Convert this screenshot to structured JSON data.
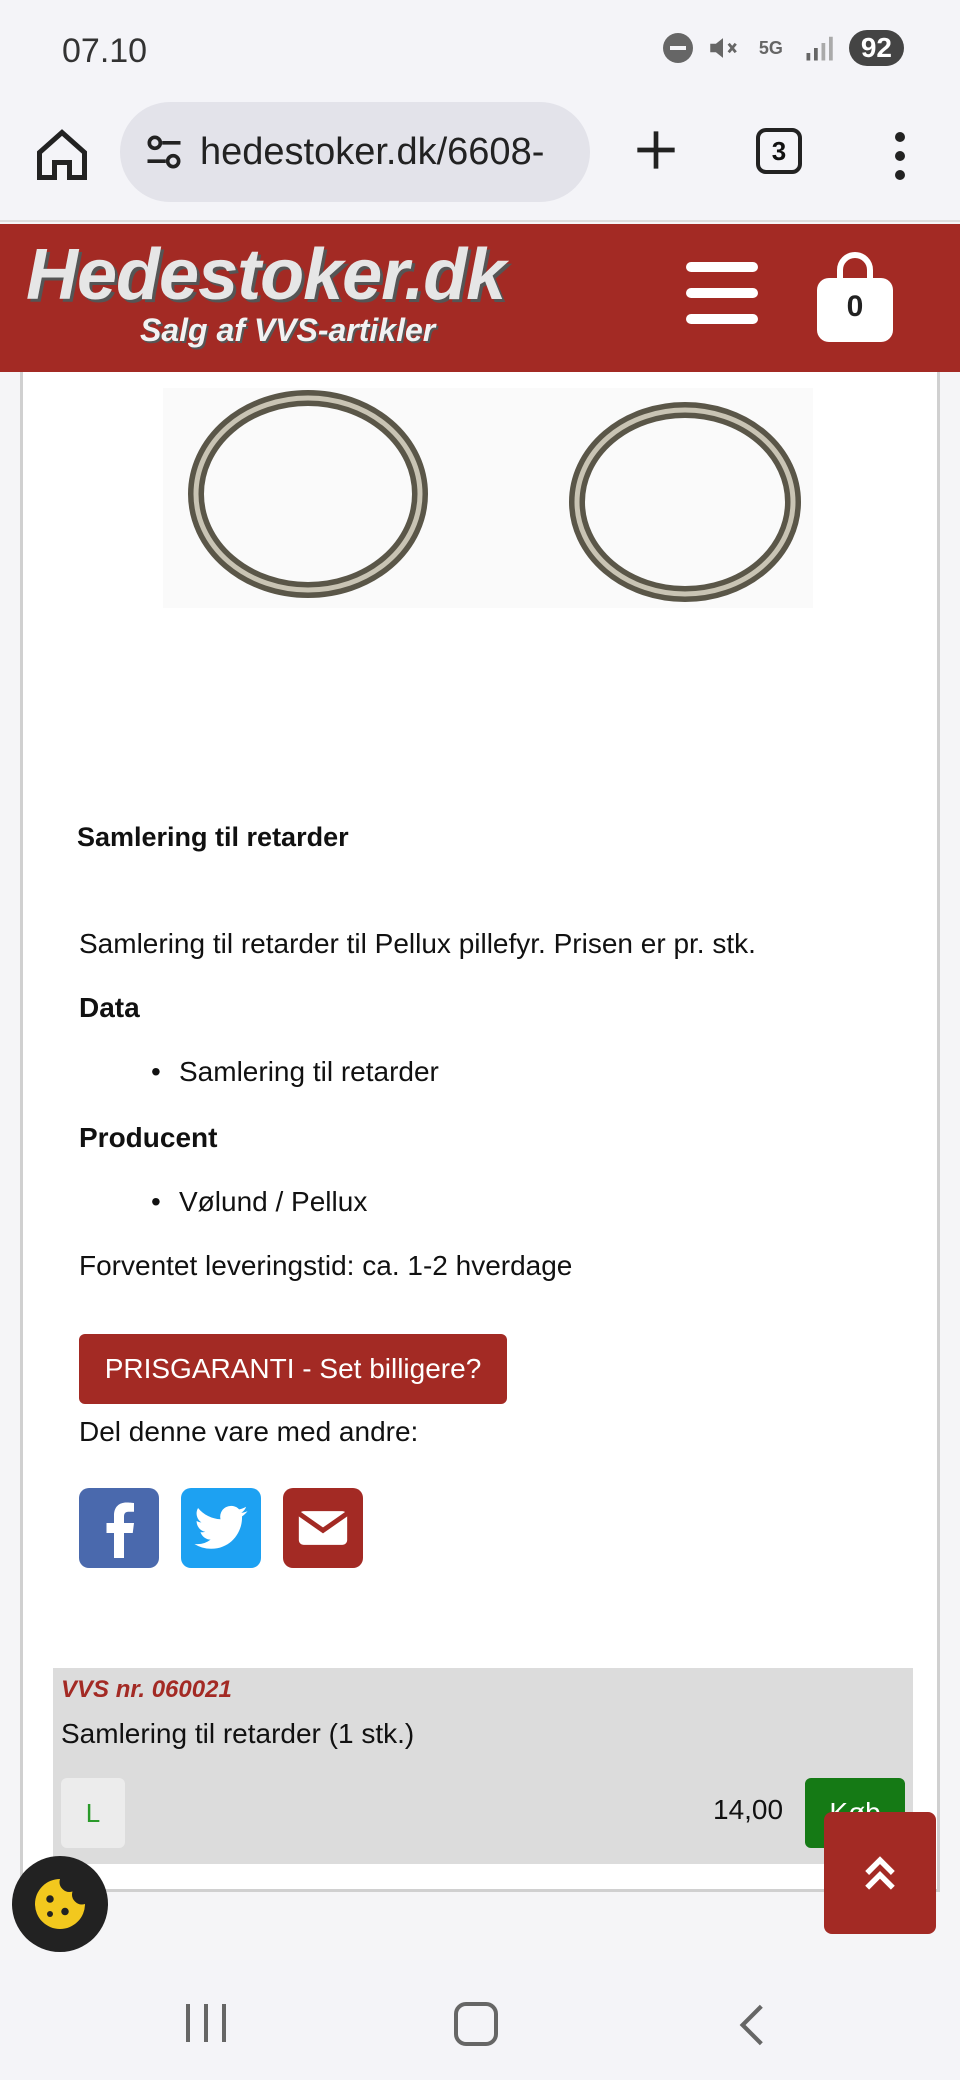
{
  "status_bar": {
    "time": "07.10",
    "battery": "92",
    "network": "5G"
  },
  "browser": {
    "url": "hedestoker.dk/6608-",
    "tab_count": "3"
  },
  "site": {
    "logo_main": "Hedestoker.dk",
    "logo_sub": "Salg af VVS-artikler",
    "cart_count": "0"
  },
  "product": {
    "heading": "Samlering til retarder",
    "description": "Samlering til retarder til Pellux  pillefyr. Prisen er pr. stk.",
    "data_label": "Data",
    "data_items": [
      "Samlering til retarder"
    ],
    "producer_label": "Producent",
    "producer_items": [
      "Vølund / Pellux"
    ],
    "delivery": "Forventet leveringstid: ca. 1-2 hverdage",
    "price_guarantee": "PRISGARANTI - Set billigere?",
    "share_label": "Del denne vare med andre:",
    "share_icons": [
      "facebook-icon",
      "twitter-icon",
      "email-icon"
    ]
  },
  "product_row": {
    "vvs_nr": "VVS nr. 060021",
    "title": "Samlering til retarder (1 stk.)",
    "stock": "L",
    "price": "14,00",
    "buy_label": "Køb"
  },
  "colors": {
    "brand": "#a32a24",
    "buy": "#157a15",
    "facebook": "#4a69ad",
    "twitter": "#1da1f2"
  }
}
